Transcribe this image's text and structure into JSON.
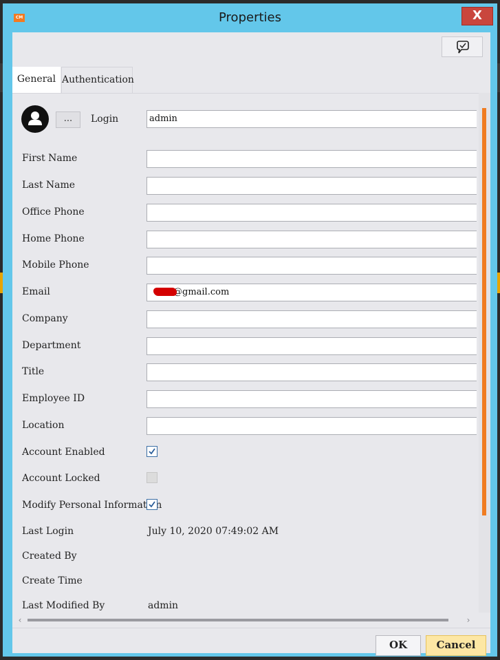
{
  "window": {
    "title": "Properties",
    "app_icon_text": "CM",
    "close_label": "X"
  },
  "toolbar": {
    "feedback_icon": "speech-bubble-icon"
  },
  "tabs": [
    {
      "label": "General",
      "active": true
    },
    {
      "label": "Authentication",
      "active": false
    }
  ],
  "general": {
    "browse_button_label": "...",
    "login": {
      "label": "Login",
      "value": "admin"
    },
    "fields": [
      {
        "label": "First Name",
        "value": ""
      },
      {
        "label": "Last Name",
        "value": ""
      },
      {
        "label": "Office Phone",
        "value": ""
      },
      {
        "label": "Home Phone",
        "value": ""
      },
      {
        "label": "Mobile Phone",
        "value": ""
      },
      {
        "label": "Email",
        "value": "@gmail.com"
      },
      {
        "label": "Company",
        "value": ""
      },
      {
        "label": "Department",
        "value": ""
      },
      {
        "label": "Title",
        "value": ""
      },
      {
        "label": "Employee ID",
        "value": ""
      },
      {
        "label": "Location",
        "value": ""
      }
    ],
    "checkboxes": [
      {
        "label": "Account Enabled",
        "checked": true,
        "enabled": true
      },
      {
        "label": "Account Locked",
        "checked": false,
        "enabled": false
      },
      {
        "label": "Modify Personal Information",
        "checked": true,
        "enabled": true
      }
    ],
    "info": [
      {
        "label": "Last Login",
        "value": "July 10, 2020 07:49:02 AM"
      },
      {
        "label": "Created By",
        "value": ""
      },
      {
        "label": "Create Time",
        "value": ""
      },
      {
        "label": "Last Modified By",
        "value": "admin"
      }
    ]
  },
  "footer": {
    "ok_label": "OK",
    "cancel_label": "Cancel"
  },
  "colors": {
    "titlebar": "#63c7ea",
    "close_button": "#c9463d",
    "scroll_thumb": "#f07c22",
    "cancel_button": "#fde7a4"
  }
}
